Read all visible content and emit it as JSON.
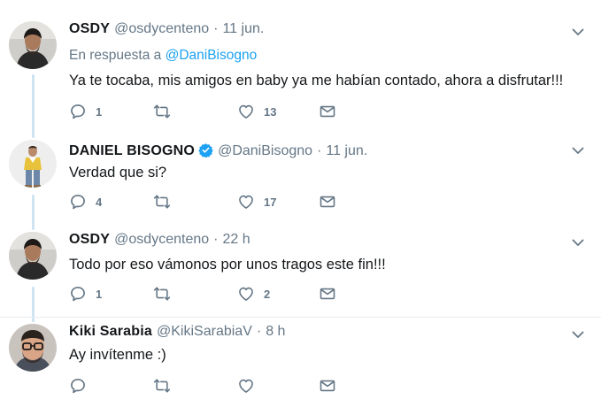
{
  "tweets": [
    {
      "name": "OSDY",
      "handle": "@osdycenteno",
      "separator": "·",
      "time": "11 jun.",
      "reply_prefix": "En respuesta a",
      "reply_handle": "@DaniBisogno",
      "text": "Ya te tocaba, mis amigos en baby ya me habían contado, ahora a disfrutar!!!",
      "replies": "1",
      "retweets": "",
      "likes": "13",
      "avatar": "man-dark-hair-avatar"
    },
    {
      "name": "DANIEL BISOGNO",
      "verified": true,
      "handle": "@DaniBisogno",
      "separator": "·",
      "time": "11 jun.",
      "text": "Verdad que si?",
      "replies": "4",
      "retweets": "",
      "likes": "17",
      "avatar": "man-yellow-shirt-avatar"
    },
    {
      "name": "OSDY",
      "handle": "@osdycenteno",
      "separator": "·",
      "time": "22 h",
      "text": "Todo por eso vámonos por unos tragos este fin!!!",
      "replies": "1",
      "retweets": "",
      "likes": "2",
      "avatar": "man-dark-hair-avatar"
    },
    {
      "name": "Kiki Sarabia",
      "handle": "@KikiSarabiaV",
      "separator": "·",
      "time": "8 h",
      "text": "Ay invítenme :)",
      "replies": "",
      "retweets": "",
      "likes": "",
      "avatar": "man-glasses-avatar"
    }
  ],
  "icons": {
    "reply": "reply-icon",
    "retweet": "retweet-icon",
    "like": "heart-icon",
    "dm": "envelope-icon",
    "menu": "chevron-down-icon",
    "verified": "verified-badge-icon"
  },
  "colors": {
    "link": "#1da1f2",
    "muted": "#657786",
    "text": "#14171a",
    "thread_line": "#cfe3f1",
    "verified": "#1da1f2"
  }
}
